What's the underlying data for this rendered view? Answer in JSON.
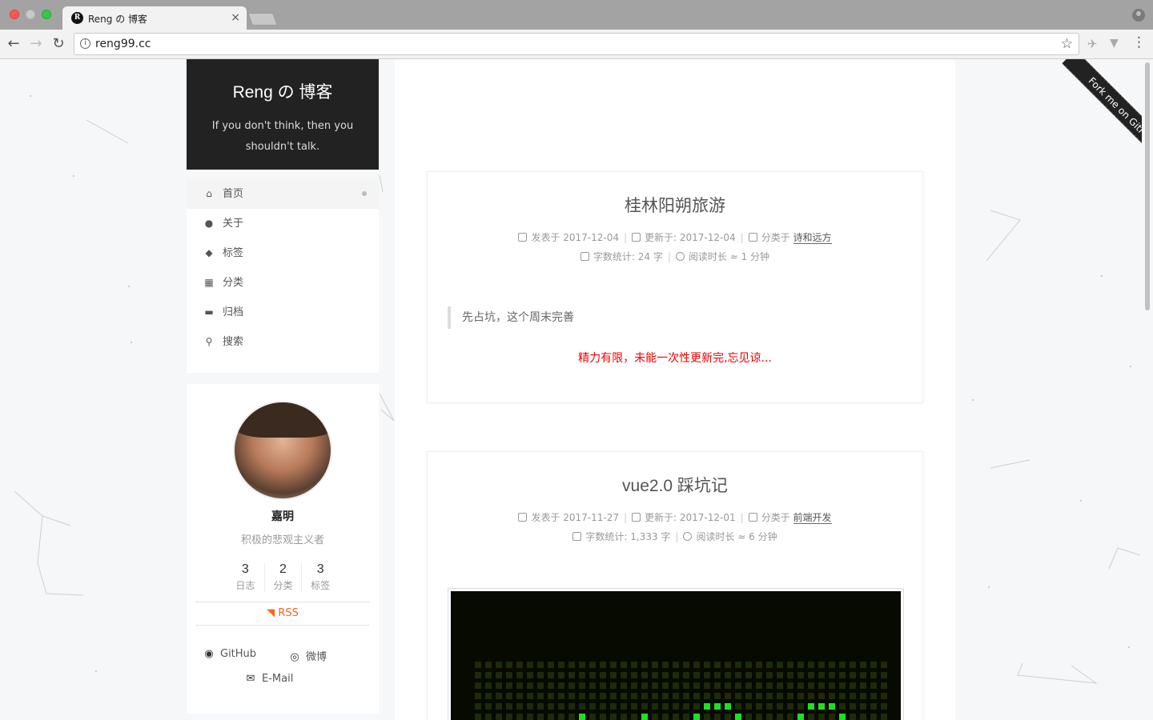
{
  "browser": {
    "tab_title": "Reng の 博客",
    "tab_favicon": "R",
    "tab_close": "×",
    "url": "reng99.cc",
    "icons": [
      "back-icon",
      "forward-icon",
      "reload-icon",
      "info-icon",
      "star-icon",
      "extension-icon",
      "menu-icon",
      "profile-icon"
    ]
  },
  "site": {
    "title": "Reng の 博客",
    "subtitle": "If you don't think, then you shouldn't talk."
  },
  "menu": [
    {
      "label": "首页",
      "icon": "home-icon",
      "glyph": "⌂",
      "active": true
    },
    {
      "label": "关于",
      "icon": "user-icon",
      "glyph": "●",
      "active": false
    },
    {
      "label": "标签",
      "icon": "tags-icon",
      "glyph": "◆",
      "active": false
    },
    {
      "label": "分类",
      "icon": "th-icon",
      "glyph": "▦",
      "active": false
    },
    {
      "label": "归档",
      "icon": "archive-icon",
      "glyph": "▬",
      "active": false
    },
    {
      "label": "搜索",
      "icon": "search-icon",
      "glyph": "⚲",
      "active": false
    }
  ],
  "author": {
    "name": "嘉明",
    "motto": "积极的悲观主义者",
    "stats": [
      {
        "count": "3",
        "label": "日志"
      },
      {
        "count": "2",
        "label": "分类"
      },
      {
        "count": "3",
        "label": "标签"
      }
    ],
    "rss": "RSS",
    "links": {
      "github": "GitHub",
      "weibo": "微博",
      "email": "E-Mail"
    }
  },
  "posts": [
    {
      "title": "桂林阳朔旅游",
      "posted": "发表于 2017-12-04",
      "updated": "更新于: 2017-12-04",
      "category_prefix": "分类于",
      "category": "诗和远方",
      "wordcount": "字数统计: 24 字",
      "readtime": "阅读时长 ≈ 1 分钟",
      "quote": "先占坑，这个周末完善",
      "notice": "精力有限，未能一次性更新完,忘见谅..."
    },
    {
      "title": "vue2.0 踩坑记",
      "posted": "发表于 2017-11-27",
      "updated": "更新于: 2017-12-01",
      "category_prefix": "分类于",
      "category": "前端开发",
      "wordcount": "字数统计: 1,333 字",
      "readtime": "阅读时长 ≈ 6 分钟"
    }
  ],
  "ribbon": "Fork me on GitHub",
  "colors": {
    "brand_bg": "#222222",
    "rss": "#fc6423",
    "notice": "#ee0000",
    "led_green": "#1ee020"
  }
}
